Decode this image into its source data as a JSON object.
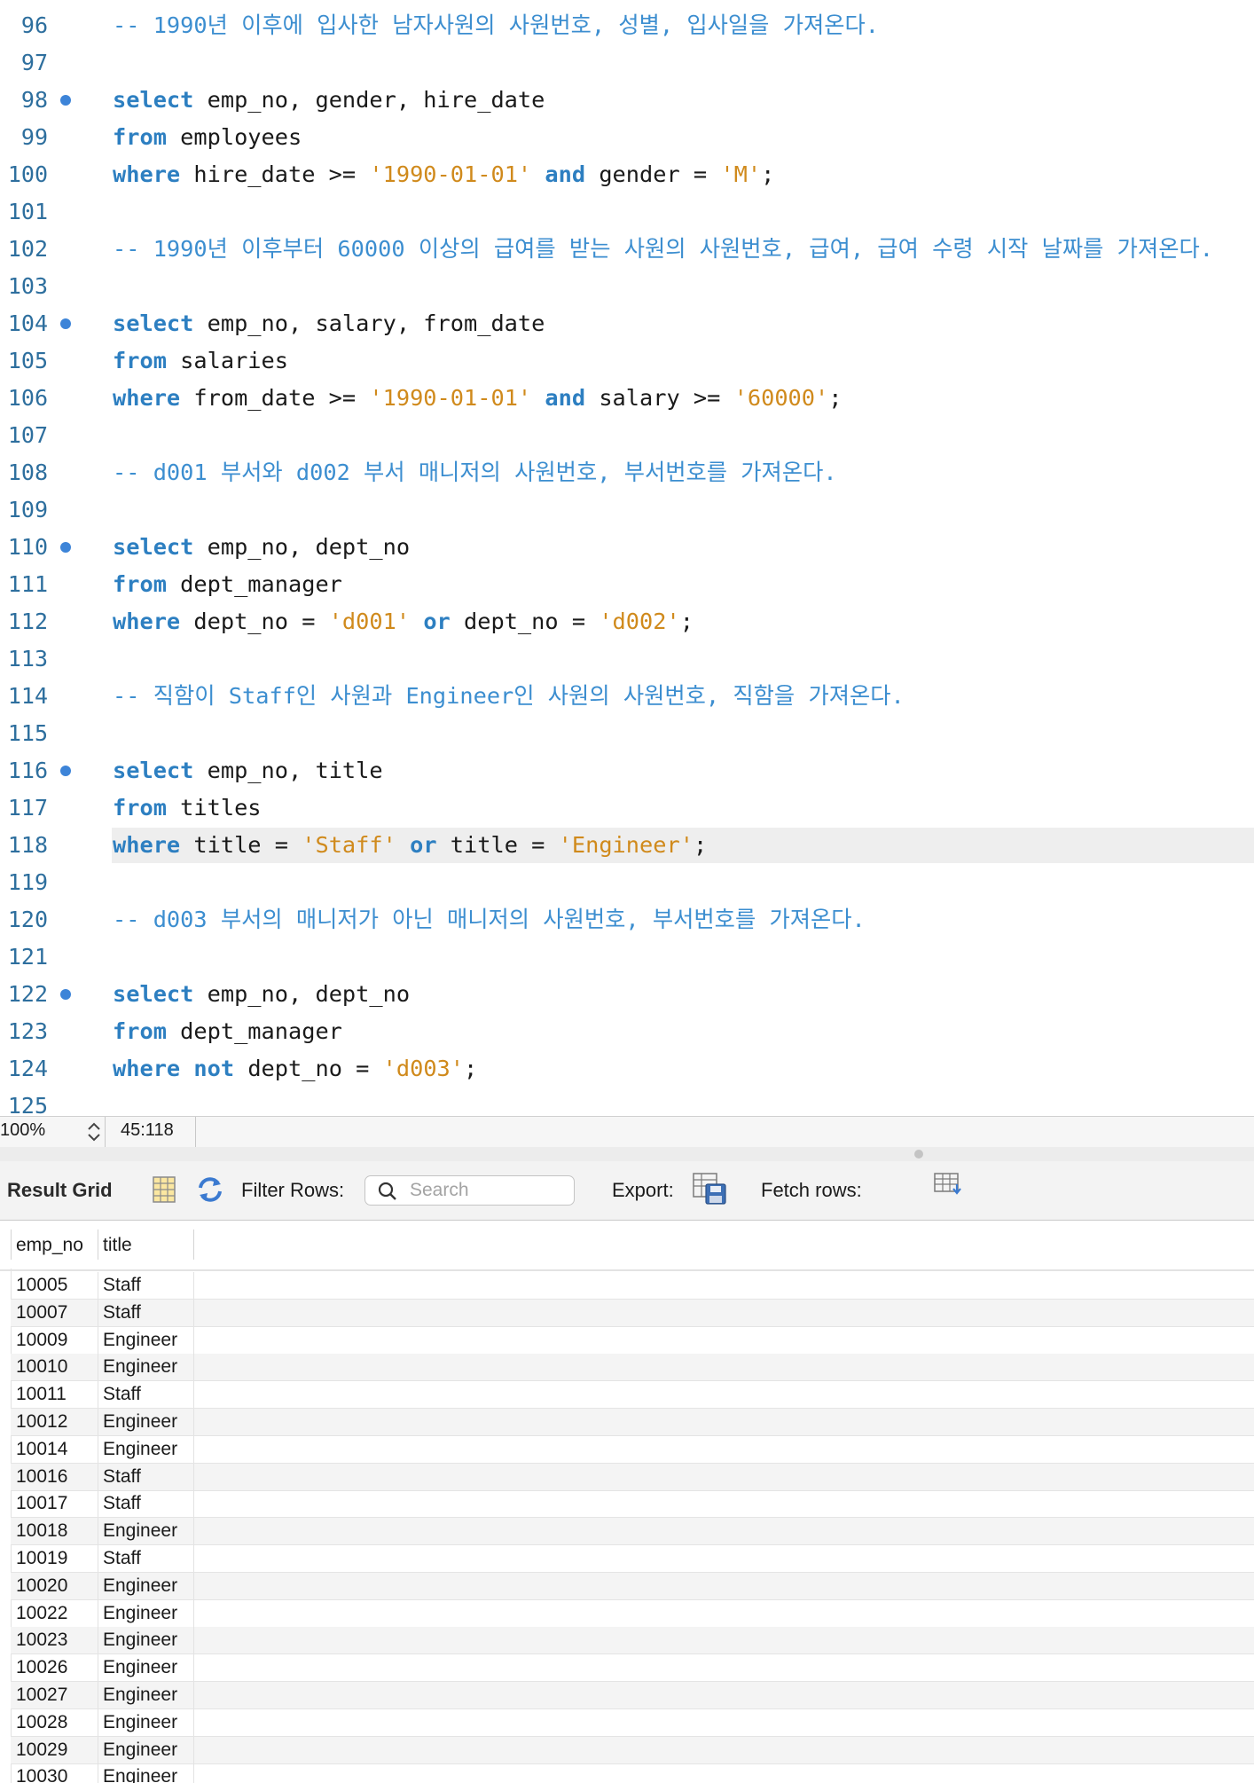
{
  "editor": {
    "lines": [
      {
        "n": "96",
        "dot": false,
        "tokens": [
          [
            "cmt",
            "-- 1990년 이후에 입사한 남자사원의 사원번호, 성별, 입사일을 가져온다."
          ]
        ]
      },
      {
        "n": "97",
        "dot": false,
        "tokens": []
      },
      {
        "n": "98",
        "dot": true,
        "tokens": [
          [
            "kw",
            "select"
          ],
          [
            "txt",
            " emp_no, gender, hire_date"
          ]
        ]
      },
      {
        "n": "99",
        "dot": false,
        "tokens": [
          [
            "kw",
            "from"
          ],
          [
            "txt",
            " employees"
          ]
        ]
      },
      {
        "n": "100",
        "dot": false,
        "tokens": [
          [
            "kw",
            "where"
          ],
          [
            "txt",
            " hire_date >= "
          ],
          [
            "str",
            "'1990-01-01'"
          ],
          [
            "txt",
            " "
          ],
          [
            "kw",
            "and"
          ],
          [
            "txt",
            " gender = "
          ],
          [
            "str",
            "'M'"
          ],
          [
            "txt",
            ";"
          ]
        ]
      },
      {
        "n": "101",
        "dot": false,
        "tokens": []
      },
      {
        "n": "102",
        "dot": false,
        "tokens": [
          [
            "cmt",
            "-- 1990년 이후부터 60000 이상의 급여를 받는 사원의 사원번호, 급여, 급여 수령 시작 날짜를 가져온다."
          ]
        ]
      },
      {
        "n": "103",
        "dot": false,
        "tokens": []
      },
      {
        "n": "104",
        "dot": true,
        "tokens": [
          [
            "kw",
            "select"
          ],
          [
            "txt",
            " emp_no, salary, from_date"
          ]
        ]
      },
      {
        "n": "105",
        "dot": false,
        "tokens": [
          [
            "kw",
            "from"
          ],
          [
            "txt",
            " salaries"
          ]
        ]
      },
      {
        "n": "106",
        "dot": false,
        "tokens": [
          [
            "kw",
            "where"
          ],
          [
            "txt",
            " from_date >= "
          ],
          [
            "str",
            "'1990-01-01'"
          ],
          [
            "txt",
            " "
          ],
          [
            "kw",
            "and"
          ],
          [
            "txt",
            " salary >= "
          ],
          [
            "str",
            "'60000'"
          ],
          [
            "txt",
            ";"
          ]
        ]
      },
      {
        "n": "107",
        "dot": false,
        "tokens": []
      },
      {
        "n": "108",
        "dot": false,
        "tokens": [
          [
            "cmt",
            "-- d001 부서와 d002 부서 매니저의 사원번호, 부서번호를 가져온다."
          ]
        ]
      },
      {
        "n": "109",
        "dot": false,
        "tokens": []
      },
      {
        "n": "110",
        "dot": true,
        "tokens": [
          [
            "kw",
            "select"
          ],
          [
            "txt",
            " emp_no, dept_no"
          ]
        ]
      },
      {
        "n": "111",
        "dot": false,
        "tokens": [
          [
            "kw",
            "from"
          ],
          [
            "txt",
            " dept_manager"
          ]
        ]
      },
      {
        "n": "112",
        "dot": false,
        "tokens": [
          [
            "kw",
            "where"
          ],
          [
            "txt",
            " dept_no = "
          ],
          [
            "str",
            "'d001'"
          ],
          [
            "txt",
            " "
          ],
          [
            "kw",
            "or"
          ],
          [
            "txt",
            " dept_no = "
          ],
          [
            "str",
            "'d002'"
          ],
          [
            "txt",
            ";"
          ]
        ]
      },
      {
        "n": "113",
        "dot": false,
        "tokens": []
      },
      {
        "n": "114",
        "dot": false,
        "tokens": [
          [
            "cmt",
            "-- 직함이 Staff인 사원과 Engineer인 사원의 사원번호, 직함을 가져온다."
          ]
        ]
      },
      {
        "n": "115",
        "dot": false,
        "tokens": []
      },
      {
        "n": "116",
        "dot": true,
        "tokens": [
          [
            "kw",
            "select"
          ],
          [
            "txt",
            " emp_no, title"
          ]
        ]
      },
      {
        "n": "117",
        "dot": false,
        "tokens": [
          [
            "kw",
            "from"
          ],
          [
            "txt",
            " titles"
          ]
        ]
      },
      {
        "n": "118",
        "dot": false,
        "current": true,
        "tokens": [
          [
            "kw",
            "where"
          ],
          [
            "txt",
            " title = "
          ],
          [
            "str",
            "'Staff'"
          ],
          [
            "txt",
            " "
          ],
          [
            "kw",
            "or"
          ],
          [
            "txt",
            " title = "
          ],
          [
            "str",
            "'Engineer'"
          ],
          [
            "txt",
            ";"
          ]
        ]
      },
      {
        "n": "119",
        "dot": false,
        "tokens": []
      },
      {
        "n": "120",
        "dot": false,
        "tokens": [
          [
            "cmt",
            "-- d003 부서의 매니저가 아닌 매니저의 사원번호, 부서번호를 가져온다."
          ]
        ]
      },
      {
        "n": "121",
        "dot": false,
        "tokens": []
      },
      {
        "n": "122",
        "dot": true,
        "tokens": [
          [
            "kw",
            "select"
          ],
          [
            "txt",
            " emp_no, dept_no"
          ]
        ]
      },
      {
        "n": "123",
        "dot": false,
        "tokens": [
          [
            "kw",
            "from"
          ],
          [
            "txt",
            " dept_manager"
          ]
        ]
      },
      {
        "n": "124",
        "dot": false,
        "tokens": [
          [
            "kw",
            "where"
          ],
          [
            "txt",
            " "
          ],
          [
            "kw",
            "not"
          ],
          [
            "txt",
            " dept_no = "
          ],
          [
            "str",
            "'d003'"
          ],
          [
            "txt",
            ";"
          ]
        ]
      },
      {
        "n": "125",
        "dot": false,
        "tokens": []
      }
    ]
  },
  "status": {
    "zoom": "100%",
    "cursor": "45:118"
  },
  "colors": {
    "keyword": "#2d7fc1",
    "string": "#d08a1c",
    "comment": "#3c8ed0",
    "gutter_dot": "#3d84d8"
  },
  "toolbar": {
    "result_grid": "Result Grid",
    "filter_rows": "Filter Rows:",
    "search_placeholder": "Search",
    "export": "Export:",
    "fetch_rows": "Fetch rows:"
  },
  "icons": {
    "grid": "grid-icon",
    "refresh": "refresh-icon",
    "search": "search-icon",
    "export": "export-icon",
    "fetch": "fetch-rows-icon"
  },
  "grid": {
    "columns": [
      "emp_no",
      "title"
    ],
    "rows": [
      [
        "10005",
        "Staff"
      ],
      [
        "10007",
        "Staff"
      ],
      [
        "10009",
        "Engineer"
      ],
      [
        "10010",
        "Engineer"
      ],
      [
        "10011",
        "Staff"
      ],
      [
        "10012",
        "Engineer"
      ],
      [
        "10014",
        "Engineer"
      ],
      [
        "10016",
        "Staff"
      ],
      [
        "10017",
        "Staff"
      ],
      [
        "10018",
        "Engineer"
      ],
      [
        "10019",
        "Staff"
      ],
      [
        "10020",
        "Engineer"
      ],
      [
        "10022",
        "Engineer"
      ],
      [
        "10023",
        "Engineer"
      ],
      [
        "10026",
        "Engineer"
      ],
      [
        "10027",
        "Engineer"
      ],
      [
        "10028",
        "Engineer"
      ],
      [
        "10029",
        "Engineer"
      ],
      [
        "10030",
        "Engineer"
      ]
    ]
  }
}
